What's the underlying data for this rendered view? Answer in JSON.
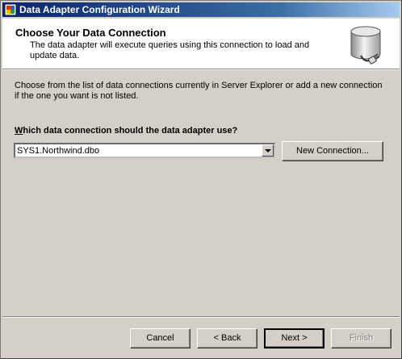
{
  "window": {
    "title": "Data Adapter Configuration Wizard"
  },
  "header": {
    "title": "Choose Your Data Connection",
    "subtitle": "The data adapter will execute queries using this connection to load and update data.",
    "icon": "database-plug-icon"
  },
  "body": {
    "intro": "Choose from the list of data connections currently in Server Explorer or add a new connection if the one you want is not listed.",
    "question_prefix": "W",
    "question_rest": "hich data connection should the data adapter use?",
    "connection": {
      "selected": "SYS1.Northwind.dbo"
    },
    "new_connection_label": "New Connection..."
  },
  "footer": {
    "cancel": "Cancel",
    "back": "< Back",
    "next": "Next >",
    "finish": "Finish"
  },
  "colors": {
    "titlebar_start": "#0a246a",
    "titlebar_end": "#a6caf0",
    "face": "#d4d0c8"
  }
}
